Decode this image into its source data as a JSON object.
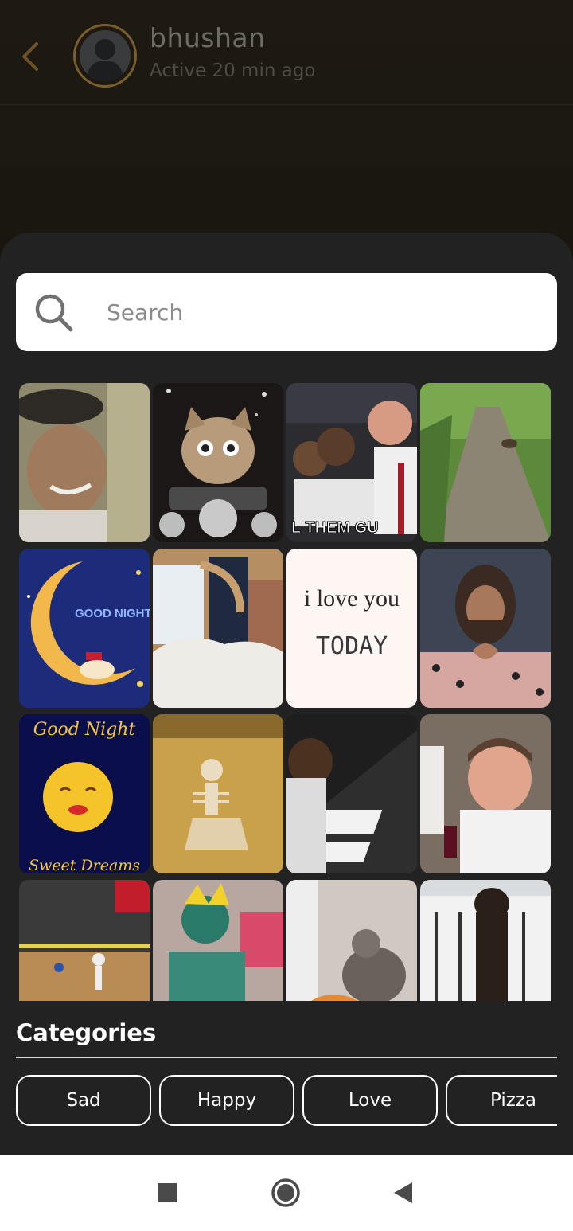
{
  "header": {
    "contact_name": "bhushan",
    "contact_status": "Active 20 min ago",
    "back_icon": "chevron-left-icon",
    "avatar_icon": "person-silhouette-icon"
  },
  "search": {
    "placeholder": "Search",
    "icon": "search-icon"
  },
  "gifs": [
    {
      "id": "gif-1",
      "description": "laughing man in cap"
    },
    {
      "id": "gif-2",
      "description": "cat on motorcycle"
    },
    {
      "id": "gif-3",
      "description": "boxer interview",
      "caption": "L THEM GU"
    },
    {
      "id": "gif-4",
      "description": "forest path"
    },
    {
      "id": "gif-5",
      "description": "good night moon",
      "caption": "GOOD NIGHT"
    },
    {
      "id": "gif-6",
      "description": "waking up in bed"
    },
    {
      "id": "gif-7",
      "description": "i love you today text",
      "caption": "i love you",
      "caption2": "TODAY"
    },
    {
      "id": "gif-8",
      "description": "man making heart hands"
    },
    {
      "id": "gif-9",
      "description": "good night sweet dreams moon",
      "caption": "Good Night",
      "caption2": "Sweet Dreams"
    },
    {
      "id": "gif-10",
      "description": "skeleton waiting"
    },
    {
      "id": "gif-11",
      "description": "man playing piano"
    },
    {
      "id": "gif-12",
      "description": "man drinking wine"
    },
    {
      "id": "gif-13",
      "description": "basketball game"
    },
    {
      "id": "gif-14",
      "description": "green painted man"
    },
    {
      "id": "gif-15",
      "description": "cats playing"
    },
    {
      "id": "gif-16",
      "description": "dog standing at gate"
    }
  ],
  "categories": {
    "title": "Categories",
    "items": [
      "Sad",
      "Happy",
      "Love",
      "Pizza"
    ]
  },
  "colors": {
    "sheet_bg": "#222222",
    "accent_ring": "#7a5f2c",
    "nav_bg": "#ffffff"
  },
  "nav": {
    "recent_icon": "square-icon",
    "home_icon": "circle-icon",
    "back_icon": "triangle-back-icon"
  }
}
